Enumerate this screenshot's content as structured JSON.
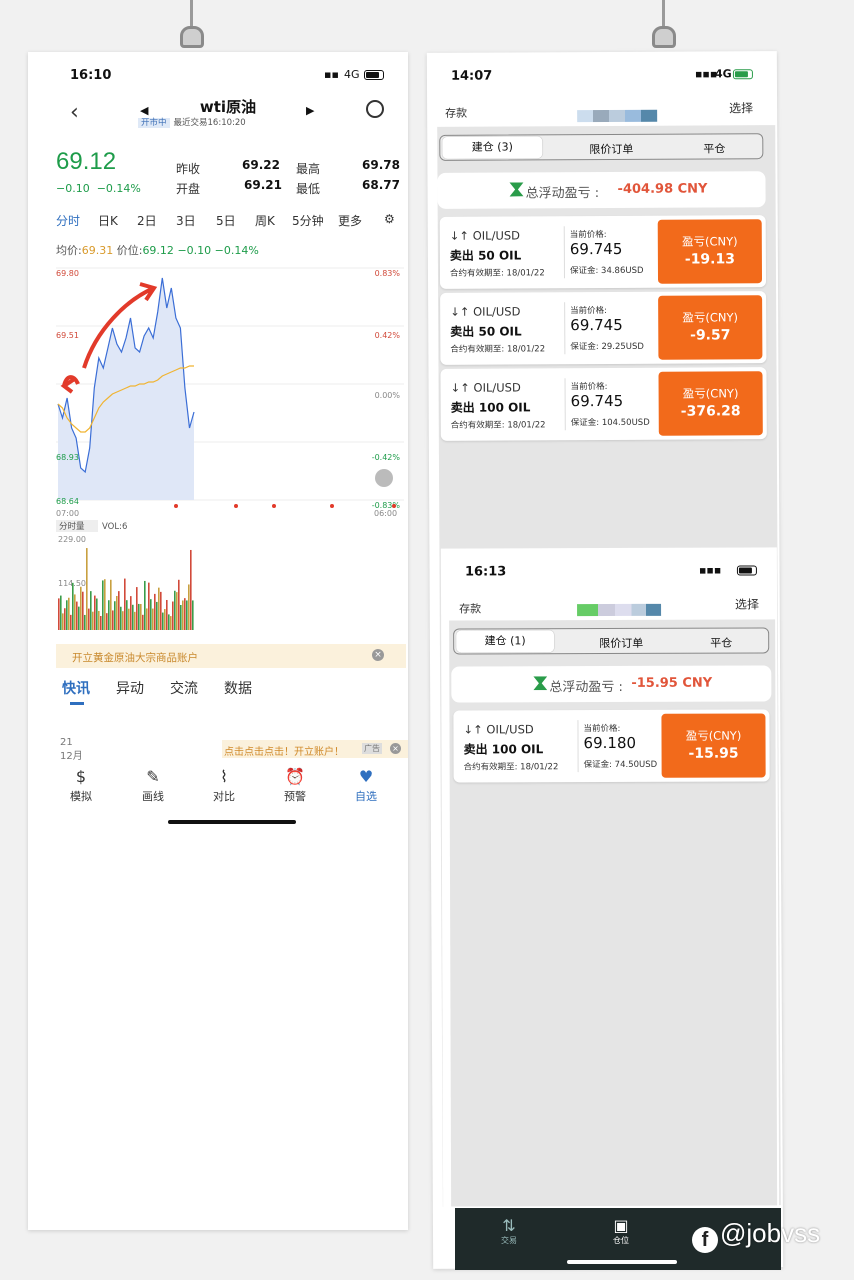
{
  "left": {
    "status": {
      "time": "16:10",
      "network": "4G"
    },
    "nav": {
      "title": "wti原油",
      "status_tag": "开市中",
      "last_trade": "最近交易16:10:20"
    },
    "price": {
      "last": "69.12",
      "change": "−0.10",
      "change_pct": "−0.14%"
    },
    "quote": {
      "prev_close_label": "昨收",
      "prev_close": "69.22",
      "high_label": "最高",
      "high": "69.78",
      "open_label": "开盘",
      "open": "69.21",
      "low_label": "最低",
      "low": "68.77"
    },
    "tabs": [
      "分时",
      "日K",
      "2日",
      "3日",
      "5日",
      "周K",
      "5分钟",
      "更多"
    ],
    "avgline": {
      "avg_label": "均价:",
      "avg": "69.31",
      "price_label": "价位:",
      "price": "69.12",
      "chg": "−0.10",
      "chg_pct": "−0.14%"
    },
    "chart_data": {
      "type": "line",
      "yticks_left": [
        "69.80",
        "69.51",
        "68.93",
        "68.64"
      ],
      "yticks_right": [
        "0.83%",
        "0.42%",
        "0.00%",
        "-0.42%",
        "-0.83%"
      ],
      "xticks": [
        "07:00",
        "06:00"
      ],
      "ylim": [
        68.64,
        69.8
      ],
      "series": [
        {
          "values": [
            69.12,
            69.05,
            69.15,
            69.0,
            68.95,
            68.8,
            68.78,
            68.9,
            69.2,
            69.35,
            69.3,
            69.4,
            69.5,
            69.42,
            69.38,
            69.45,
            69.55,
            69.4,
            69.38,
            69.46,
            69.5,
            69.45,
            69.58,
            69.75,
            69.6,
            69.7,
            69.55,
            69.5,
            69.2,
            69.0,
            69.08
          ]
        },
        {
          "values": [
            69.12,
            69.1,
            69.05,
            69.02,
            69.0,
            68.98,
            68.98,
            69.0,
            69.05,
            69.1,
            69.13,
            69.15,
            69.17,
            69.18,
            69.19,
            69.2,
            69.21,
            69.21,
            69.22,
            69.22,
            69.23,
            69.23,
            69.24,
            69.26,
            69.27,
            69.28,
            69.29,
            69.3,
            69.3,
            69.31,
            69.31
          ]
        }
      ]
    },
    "volume": {
      "selector": "分时量",
      "vol_label": "VOL:6",
      "yticks": [
        "229.00",
        "114.50"
      ]
    },
    "banner": "开立黄金原油大宗商品账户",
    "news_tabs": [
      "快讯",
      "异动",
      "交流",
      "数据"
    ],
    "date": {
      "day": "21",
      "month": "12月"
    },
    "ad": {
      "text": "点击点击点击！开立账户！",
      "tag": "广告"
    },
    "bottom_nav": [
      "模拟",
      "画线",
      "对比",
      "预警",
      "自选"
    ]
  },
  "right": {
    "status": {
      "time": "14:07",
      "network": "4G"
    },
    "header": {
      "left": "存款",
      "right": "选择"
    },
    "segments": [
      "建仓 (3)",
      "限价订单",
      "平仓"
    ],
    "total": {
      "label": "总浮动盈亏 :",
      "value": "-404.98 CNY"
    },
    "positions": [
      {
        "pair": "↓↑ OIL/USD",
        "side": "卖出 50 OIL",
        "expiry": "合约有效期至: 18/01/22",
        "cp_label": "当前价格:",
        "cp": "69.745",
        "margin": "保证金:  34.86USD",
        "pl_label": "盈亏(CNY)",
        "pl": "-19.13"
      },
      {
        "pair": "↓↑ OIL/USD",
        "side": "卖出 50 OIL",
        "expiry": "合约有效期至: 18/01/22",
        "cp_label": "当前价格:",
        "cp": "69.745",
        "margin": "保证金:  29.25USD",
        "pl_label": "盈亏(CNY)",
        "pl": "-9.57"
      },
      {
        "pair": "↓↑ OIL/USD",
        "side": "卖出 100 OIL",
        "expiry": "合约有效期至: 18/01/22",
        "cp_label": "当前价格:",
        "cp": "69.745",
        "margin": "保证金:  104.50USD",
        "pl_label": "盈亏(CNY)",
        "pl": "-376.28"
      }
    ]
  },
  "second": {
    "status": {
      "time": "16:13"
    },
    "header": {
      "left": "存款",
      "right": "选择"
    },
    "segments": [
      "建仓 (1)",
      "限价订单",
      "平仓"
    ],
    "total": {
      "label": "总浮动盈亏 :",
      "value": "-15.95 CNY"
    },
    "position": {
      "pair": "↓↑ OIL/USD",
      "side": "卖出 100 OIL",
      "expiry": "合约有效期至: 18/01/22",
      "cp_label": "当前价格:",
      "cp": "69.180",
      "margin": "保证金:  74.50USD",
      "pl_label": "盈亏(CNY)",
      "pl": "-15.95"
    }
  },
  "dark_nav": [
    "交易",
    "仓位"
  ],
  "watermark": "@jobvss",
  "colors": {
    "up": "#e1553a",
    "down": "#1e9c4a",
    "accent": "#2f6fbf",
    "pl_box": "#f26a1b"
  }
}
